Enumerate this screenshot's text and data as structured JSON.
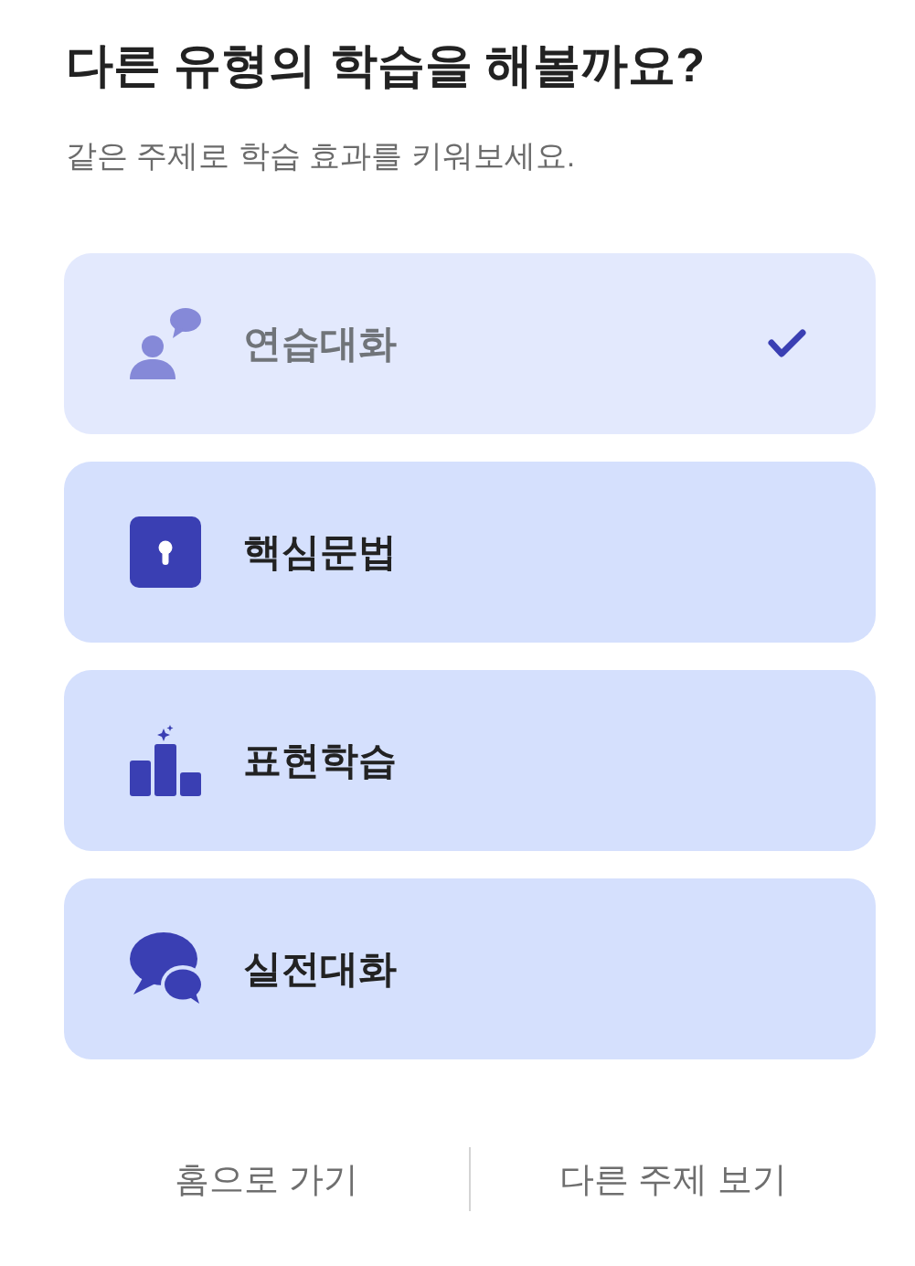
{
  "title": "다른 유형의 학습을 해볼까요?",
  "subtitle": "같은 주제로 학습 효과를 키워보세요.",
  "options": [
    {
      "kind": "person-speech",
      "label": "연습대화",
      "completed": true
    },
    {
      "kind": "keyhole",
      "label": "핵심문법",
      "completed": false
    },
    {
      "kind": "bar-chart",
      "label": "표현학습",
      "completed": false
    },
    {
      "kind": "speech-bubbles",
      "label": "실전대화",
      "completed": false
    }
  ],
  "footer_buttons": [
    "홈으로 가기",
    "다른 주제 보기"
  ]
}
